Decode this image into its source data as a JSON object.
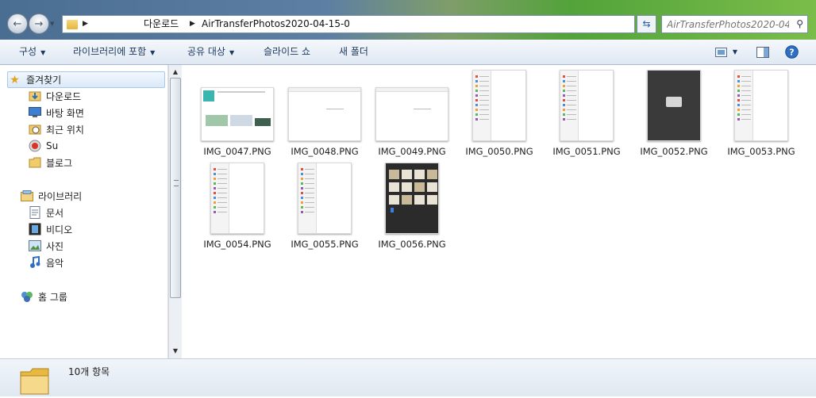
{
  "address": {
    "crumbs": [
      "다운로드",
      "AirTransferPhotos2020-04-15-0"
    ]
  },
  "search": {
    "placeholder": "AirTransferPhotos2020-04..."
  },
  "toolbar": {
    "organize": "구성",
    "include_library": "라이브러리에 포함",
    "share_with": "공유 대상",
    "slideshow": "슬라이드 쇼",
    "new_folder": "새 폴더"
  },
  "nav": {
    "favorites": "즐겨찾기",
    "fav_items": [
      {
        "label": "다운로드",
        "icon": "downloads-icon"
      },
      {
        "label": "바탕 화면",
        "icon": "desktop-icon"
      },
      {
        "label": "최근 위치",
        "icon": "recent-places-icon"
      },
      {
        "label": "Su",
        "icon": "user-icon"
      },
      {
        "label": "블로그",
        "icon": "folder-icon"
      }
    ],
    "libraries": "라이브러리",
    "lib_items": [
      {
        "label": "문서",
        "icon": "documents-icon"
      },
      {
        "label": "비디오",
        "icon": "videos-icon"
      },
      {
        "label": "사진",
        "icon": "pictures-icon"
      },
      {
        "label": "음악",
        "icon": "music-icon"
      }
    ],
    "homegroup": "홈 그룹"
  },
  "files": [
    {
      "name": "IMG_0047.PNG",
      "orientation": "landscape",
      "theme": "light-color"
    },
    {
      "name": "IMG_0048.PNG",
      "orientation": "landscape",
      "theme": "light"
    },
    {
      "name": "IMG_0049.PNG",
      "orientation": "landscape",
      "theme": "light"
    },
    {
      "name": "IMG_0050.PNG",
      "orientation": "portrait",
      "theme": "light"
    },
    {
      "name": "IMG_0051.PNG",
      "orientation": "portrait",
      "theme": "light"
    },
    {
      "name": "IMG_0052.PNG",
      "orientation": "portrait",
      "theme": "dark"
    },
    {
      "name": "IMG_0053.PNG",
      "orientation": "portrait",
      "theme": "light"
    },
    {
      "name": "IMG_0054.PNG",
      "orientation": "portrait",
      "theme": "light"
    },
    {
      "name": "IMG_0055.PNG",
      "orientation": "portrait",
      "theme": "light"
    },
    {
      "name": "IMG_0056.PNG",
      "orientation": "portrait",
      "theme": "dark-grid"
    }
  ],
  "status": {
    "count": "10개 항목"
  }
}
